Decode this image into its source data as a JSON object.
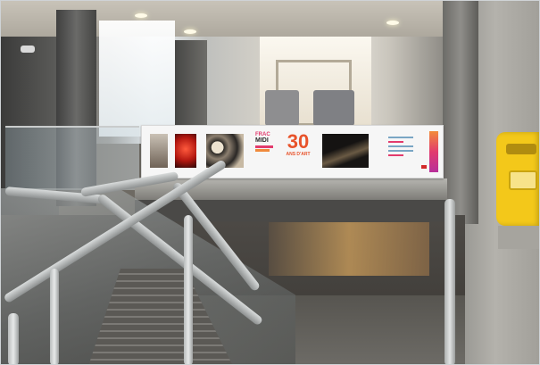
{
  "banner": {
    "frac_top": "FRAC",
    "frac_midi": "MIDI",
    "anniversary_number": "30",
    "anniversary_subtitle": "ANS D'ART"
  },
  "colors": {
    "banner_accent": "#e8532b",
    "frac_pink": "#e23b6d",
    "validator_yellow": "#f3c81a"
  }
}
